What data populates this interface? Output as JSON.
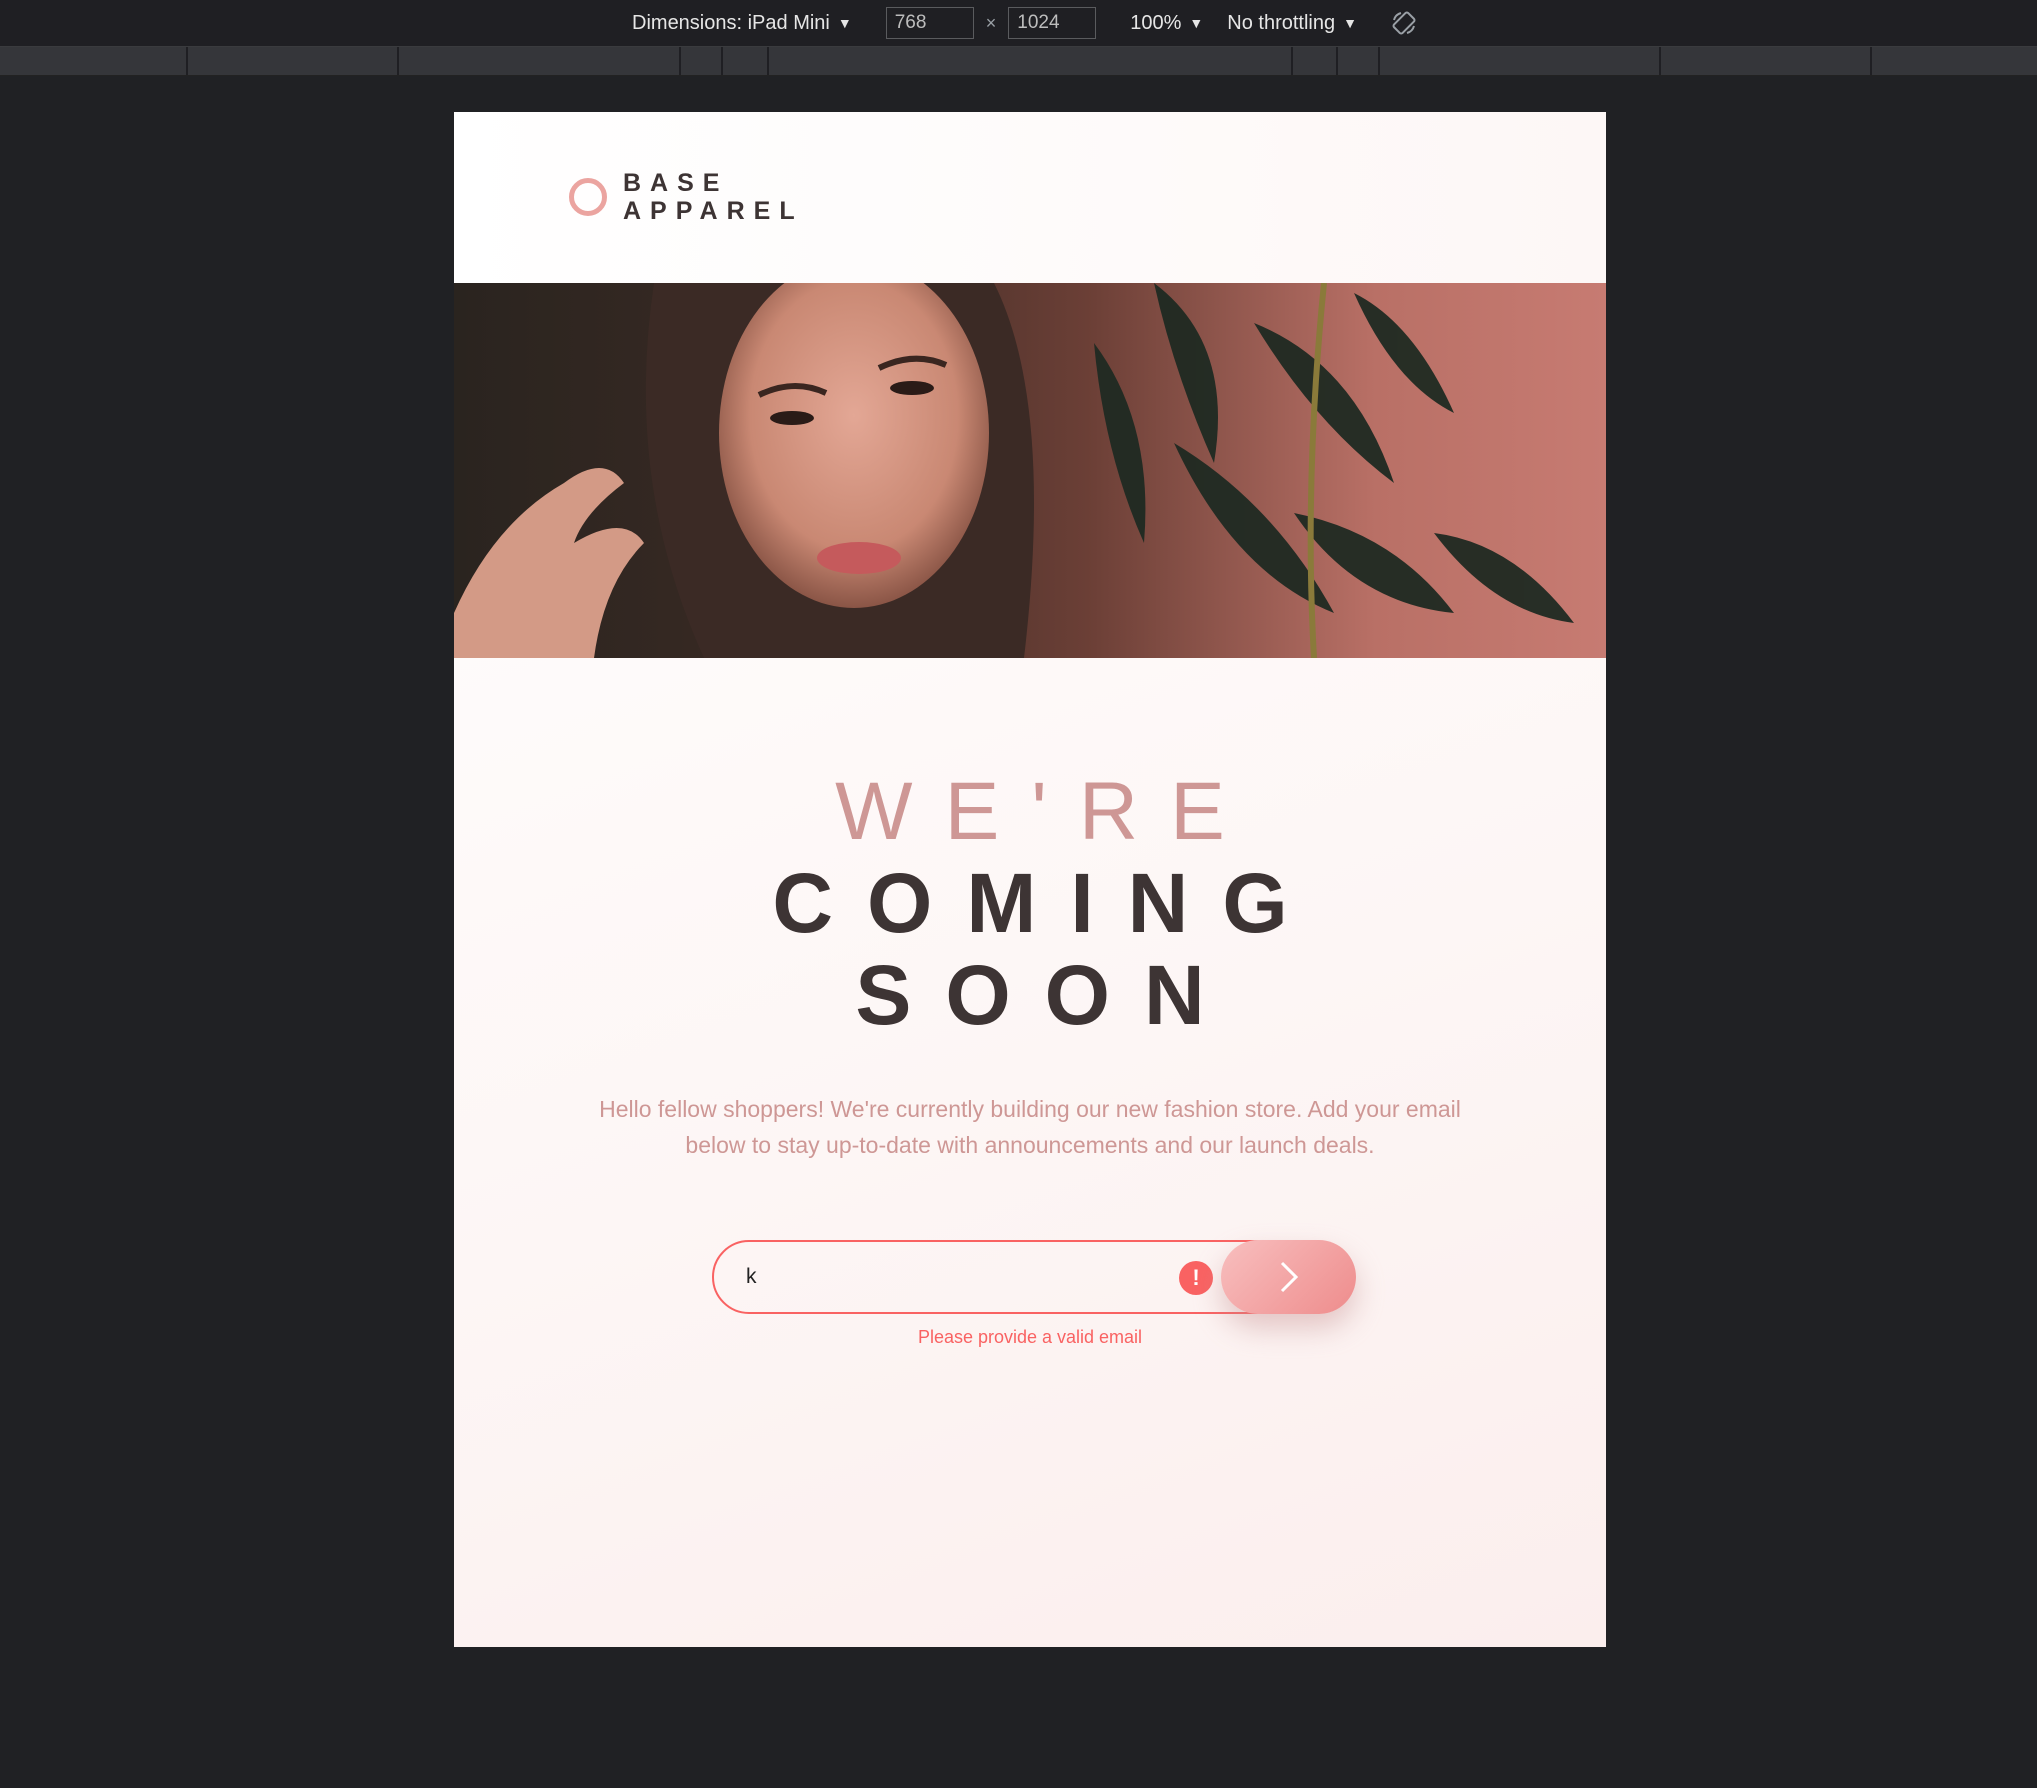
{
  "devtools": {
    "dimensions_label": "Dimensions: iPad Mini",
    "width_value": "768",
    "height_value": "1024",
    "times": "×",
    "zoom": "100%",
    "throttling": "No throttling",
    "icons": {
      "caret": "dropdown-caret-icon",
      "rotate": "rotate-icon"
    }
  },
  "page": {
    "brand": {
      "line1": "BASE",
      "line2": "APPAREL",
      "accent_color": "#eba4a0"
    },
    "hero_image_alt": "hero-photo",
    "headline": {
      "line1": "WE'RE",
      "line2": "COMING",
      "line3": "SOON"
    },
    "description": "Hello fellow shoppers! We're currently building our new fashion store. Add your email below to stay up-to-date with announcements and our launch deals.",
    "form": {
      "email_value": "k",
      "error_icon_glyph": "!",
      "error_message": "Please provide a valid email",
      "error_color": "#f96262"
    }
  }
}
